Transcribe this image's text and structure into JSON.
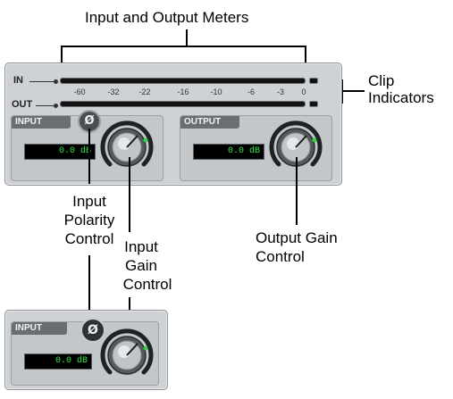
{
  "callouts": {
    "meters": "Input and Output Meters",
    "clip_line1": "Clip",
    "clip_line2": "Indicators",
    "polarity_line1": "Input",
    "polarity_line2": "Polarity",
    "polarity_line3": "Control",
    "input_gain_line1": "Input",
    "input_gain_line2": "Gain",
    "input_gain_line3": "Control",
    "output_gain_line1": "Output Gain",
    "output_gain_line2": "Control"
  },
  "panel": {
    "in_label": "IN",
    "out_label": "OUT",
    "scale_ticks": [
      "-60",
      "-32",
      "-22",
      "-16",
      "-10",
      "-6",
      "-3",
      "0"
    ],
    "input_tab": "INPUT",
    "output_tab": "OUTPUT",
    "input_readout": "0.0 dB",
    "output_readout": "0.0 dB",
    "polarity_symbol": "Ø"
  },
  "detail": {
    "input_tab": "INPUT",
    "input_readout": "0.0 dB",
    "polarity_symbol": "Ø"
  },
  "colors": {
    "panel": "#cfd2d4",
    "readout_text": "#37e64b",
    "gain_indicator": "#2fd34a"
  }
}
